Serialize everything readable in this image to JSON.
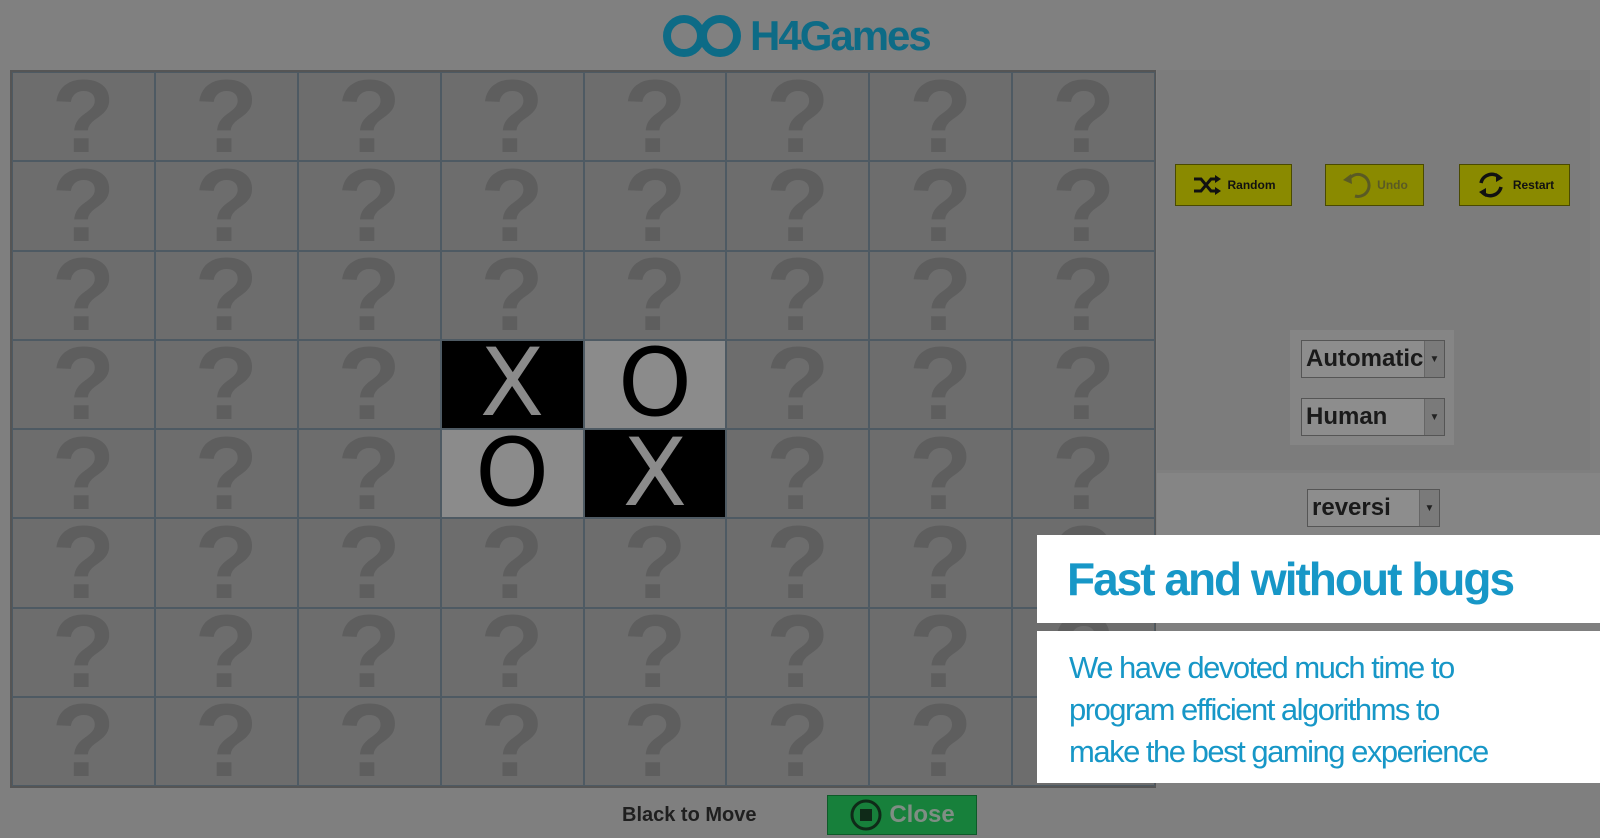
{
  "brand": {
    "logo_text": "H4Games",
    "logo_color": "#0d6b86"
  },
  "board": {
    "rows": 8,
    "cols": 8,
    "hidden_glyph": "?",
    "cells": [
      [
        "?",
        "?",
        "?",
        "?",
        "?",
        "?",
        "?",
        "?"
      ],
      [
        "?",
        "?",
        "?",
        "?",
        "?",
        "?",
        "?",
        "?"
      ],
      [
        "?",
        "?",
        "?",
        "?",
        "?",
        "?",
        "?",
        "?"
      ],
      [
        "?",
        "?",
        "?",
        "X",
        "O",
        "?",
        "?",
        "?"
      ],
      [
        "?",
        "?",
        "?",
        "O",
        "X",
        "?",
        "?",
        "?"
      ],
      [
        "?",
        "?",
        "?",
        "?",
        "?",
        "?",
        "?",
        "?"
      ],
      [
        "?",
        "?",
        "?",
        "?",
        "?",
        "?",
        "?",
        "?"
      ],
      [
        "?",
        "?",
        "?",
        "?",
        "?",
        "?",
        "?",
        "?"
      ]
    ]
  },
  "toolbar": {
    "random_label": "Random",
    "undo_label": "Undo",
    "restart_label": "Restart",
    "button_color": "#8a8a00"
  },
  "settings": {
    "mode_selected": "Automatic",
    "player_selected": "Human",
    "game_selected": "reversi"
  },
  "status": {
    "turn_text": "Black to Move",
    "close_label": "Close",
    "close_color": "#17803b"
  },
  "promo": {
    "title": "Fast and without bugs",
    "lines": [
      "We have devoted much time to",
      "program efficient algorithms to",
      "make the best gaming experience"
    ],
    "accent_color": "#1797c7"
  }
}
